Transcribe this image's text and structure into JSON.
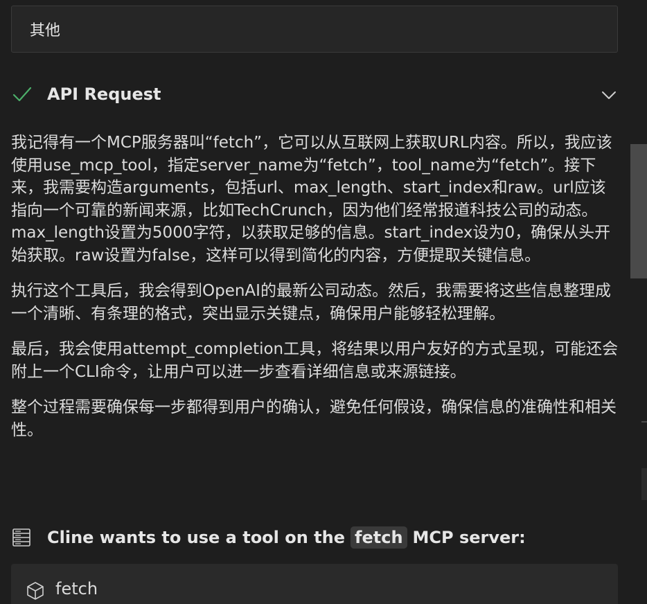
{
  "answer": {
    "text": "其他"
  },
  "api_request": {
    "title": "API Request",
    "status_icon": "check-icon",
    "toggle_icon": "chevron-down-icon"
  },
  "message": {
    "paragraphs": [
      "我记得有一个MCP服务器叫“fetch”，它可以从互联网上获取URL内容。所以，我应该使用use_mcp_tool，指定server_name为“fetch”，tool_name为“fetch”。接下来，我需要构造arguments，包括url、max_length、start_index和raw。url应该指向一个可靠的新闻来源，比如TechCrunch，因为他们经常报道科技公司的动态。max_length设置为5000字符，以获取足够的信息。start_index设为0，确保从头开始获取。raw设置为false，这样可以得到简化的内容，方便提取关键信息。",
      "执行这个工具后，我会得到OpenAI的最新公司动态。然后，我需要将这些信息整理成一个清晰、有条理的格式，突出显示关键点，确保用户能够轻松理解。",
      "最后，我会使用attempt_completion工具，将结果以用户友好的方式呈现，可能还会附上一个CLI命令，让用户可以进一步查看详细信息或来源链接。",
      "整个过程需要确保每一步都得到用户的确认，避免任何假设，确保信息的准确性和相关性。"
    ]
  },
  "tool_use": {
    "prefix": "Cline wants to use a tool on the",
    "server": "fetch",
    "suffix": "MCP server:",
    "icon": "server-icon",
    "tool_name": "fetch",
    "tool_icon": "cube-icon"
  },
  "colors": {
    "background": "#1e1e1e",
    "success": "#4caf6a",
    "text": "#dcdcdc"
  }
}
